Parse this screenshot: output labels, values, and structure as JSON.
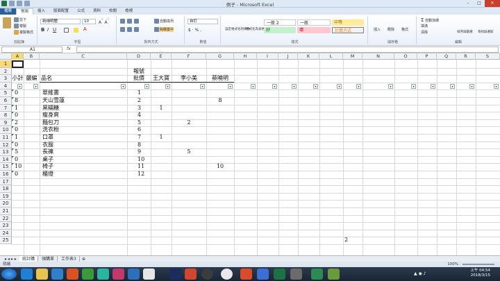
{
  "window": {
    "title": "例子 - Microsoft Excel"
  },
  "ribbon_tabs": [
    "檔案",
    "常用",
    "插入",
    "版面配置",
    "公式",
    "資料",
    "校閱",
    "檢視"
  ],
  "ribbon": {
    "clipboard": {
      "cut": "剪下",
      "copy": "複製",
      "format_painter": "複製格式",
      "label": "剪貼簿"
    },
    "font": {
      "name": "新細明體",
      "size": "10",
      "label": "字型"
    },
    "alignment": {
      "wrap": "自動換列",
      "merge": "跨欄置中",
      "label": "對齊方式"
    },
    "number": {
      "format": "自訂",
      "label": "數值"
    },
    "styles": {
      "cond_format": "設定格式化的條件",
      "format_table": "格式化為表格",
      "normal2": "一般 2",
      "normal": "一般",
      "neutral": "中等",
      "good": "好",
      "bad": "壞",
      "calc": "計算方式",
      "label": "樣式"
    },
    "cells": {
      "insert": "插入",
      "delete": "刪除",
      "format": "格式",
      "label": "儲存格"
    },
    "editing": {
      "autosum": "自動加總",
      "fill": "填滿",
      "clear": "清除",
      "sort": "排序與篩選",
      "find": "尋找與選取",
      "label": "編輯"
    }
  },
  "formula_bar": {
    "name_box": "A1",
    "fx": "fx",
    "formula": ""
  },
  "columns": [
    "A",
    "B",
    "C",
    "D",
    "E",
    "F",
    "G",
    "H",
    "I",
    "J",
    "K",
    "L",
    "M",
    "N",
    "O",
    "P",
    "Q",
    "R",
    "S"
  ],
  "row_numbers": [
    "1",
    "2",
    "3",
    "4",
    "5",
    "6",
    "7",
    "8",
    "9",
    "10",
    "11",
    "12",
    "13",
    "14",
    "15",
    "16",
    "17",
    "18",
    "19",
    "20",
    "21",
    "22",
    "23",
    "24",
    "25"
  ],
  "headers": {
    "d2": "報號",
    "a3": "小計",
    "b3": "嚴編",
    "c3": "品名",
    "d3": "批價",
    "e3": "王大寶",
    "f3": "李小美",
    "g3": "蔡曉明"
  },
  "rows": [
    {
      "a": "0",
      "c": "翠維書",
      "d": "1",
      "e": "",
      "f": "",
      "g": ""
    },
    {
      "a": "8",
      "c": "天山雪蓮",
      "d": "2",
      "e": "",
      "f": "",
      "g": "8"
    },
    {
      "a": "1",
      "c": "黑糯糖",
      "d": "3",
      "e": "1",
      "f": "",
      "g": ""
    },
    {
      "a": "0",
      "c": "瘦身爽",
      "d": "4",
      "e": "",
      "f": "",
      "g": ""
    },
    {
      "a": "2",
      "c": "麵包刀",
      "d": "5",
      "e": "",
      "f": "2",
      "g": ""
    },
    {
      "a": "0",
      "c": "洗衣粉",
      "d": "6",
      "e": "",
      "f": "",
      "g": ""
    },
    {
      "a": "1",
      "c": "口罩",
      "d": "7",
      "e": "1",
      "f": "",
      "g": ""
    },
    {
      "a": "0",
      "c": "衣服",
      "d": "8",
      "e": "",
      "f": "",
      "g": ""
    },
    {
      "a": "5",
      "c": "長褲",
      "d": "9",
      "e": "",
      "f": "5",
      "g": ""
    },
    {
      "a": "0",
      "c": "桌子",
      "d": "10",
      "e": "",
      "f": "",
      "g": ""
    },
    {
      "a": "10",
      "c": "椅子",
      "d": "11",
      "e": "",
      "f": "",
      "g": "10"
    },
    {
      "a": "0",
      "c": "櫃燈",
      "d": "12",
      "e": "",
      "f": "",
      "g": ""
    }
  ],
  "stray_m25": "2",
  "sheets": [
    "統計購",
    "領購單",
    "工作表3"
  ],
  "status": {
    "ready": "就緒",
    "zoom": "100%"
  },
  "clock": {
    "time": "上午 04:54",
    "date": "2018/3/15"
  }
}
